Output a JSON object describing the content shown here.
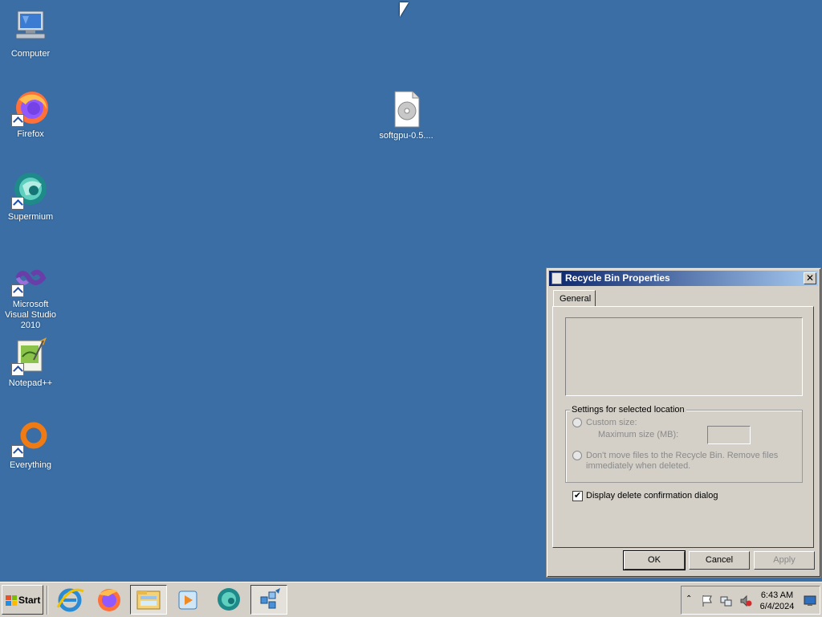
{
  "desktop": {
    "icons": [
      {
        "label": "Computer"
      },
      {
        "label": "Firefox"
      },
      {
        "label": "Supermium"
      },
      {
        "label": "Microsoft Visual Studio 2010"
      },
      {
        "label": "Notepad++"
      },
      {
        "label": "Everything"
      },
      {
        "label": "softgpu-0.5...."
      }
    ]
  },
  "dialog": {
    "title": "Recycle Bin Properties",
    "close_label": "✕",
    "tab_general": "General",
    "group_title": "Settings for selected location",
    "custom_size_label": "Custom size:",
    "max_size_label": "Maximum size (MB):",
    "max_size_value": "",
    "dont_move_label_1": "Don't move files to the Recycle Bin. Remove files",
    "dont_move_label_2": "immediately when deleted.",
    "confirm_label": "Display delete confirmation dialog",
    "confirm_checked": true,
    "check_mark": "✔",
    "ok_label": "OK",
    "cancel_label": "Cancel",
    "apply_label": "Apply"
  },
  "taskbar": {
    "start_label": "Start",
    "clock_time": "6:43 AM",
    "clock_date": "6/4/2024"
  },
  "colors": {
    "desktop": "#3a6ea5",
    "titlebar_start": "#0a246a",
    "titlebar_end": "#a6caf0",
    "face": "#d4d0c8"
  }
}
